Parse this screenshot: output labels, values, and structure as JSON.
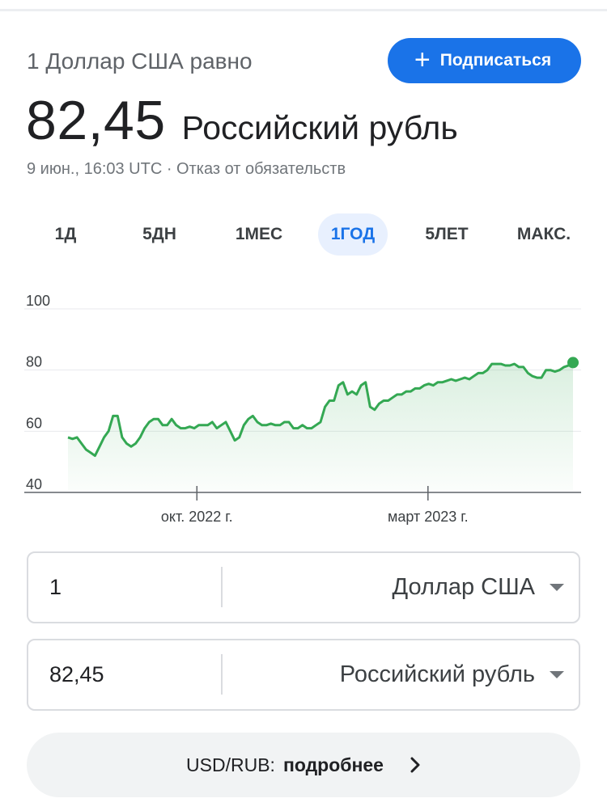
{
  "header": {
    "equals_label": "1 Доллар США равно",
    "subscribe_label": "Подписаться",
    "rate_value": "82,45",
    "rate_currency": "Российский рубль",
    "timestamp": "9 июн., 16:03 UTC · Отказ от обязательств"
  },
  "ranges": {
    "tabs": [
      "1Д",
      "5ДН",
      "1МЕС",
      "1ГОД",
      "5ЛЕТ",
      "МАКС."
    ],
    "active": "1ГОД"
  },
  "colors": {
    "accent": "#1a73e8",
    "line": "#34a853"
  },
  "chart_data": {
    "type": "line",
    "title": "",
    "xlabel": "",
    "ylabel": "",
    "ylim": [
      40,
      100
    ],
    "yticks": [
      "100",
      "80",
      "60",
      "40"
    ],
    "grid": true,
    "legend": "none",
    "x_tick_labels": [
      {
        "label": "окт. 2022 г.",
        "position": 0.31
      },
      {
        "label": "март 2023 г.",
        "position": 0.725
      }
    ],
    "series": [
      {
        "color": "#34a853",
        "values": [
          58,
          57.5,
          58,
          56,
          54,
          53,
          52,
          55,
          58,
          60,
          65,
          65,
          58,
          56,
          55,
          56,
          58,
          61,
          63,
          64,
          64,
          62,
          62,
          64,
          62,
          61,
          61,
          61.5,
          61,
          62,
          62,
          62,
          63,
          61,
          62,
          63,
          60,
          57,
          58,
          62,
          64,
          65,
          63,
          62,
          62,
          62.5,
          62,
          62,
          63,
          63,
          61,
          61,
          62,
          61,
          61,
          62,
          63,
          68,
          70,
          70,
          75,
          76,
          72,
          73,
          72,
          75,
          76,
          68,
          67,
          69,
          70,
          70,
          71,
          72,
          72,
          73,
          73,
          74,
          74,
          75,
          75.5,
          75,
          76,
          76,
          76.5,
          77,
          76.5,
          77,
          77.5,
          77,
          78,
          79,
          79,
          80,
          82,
          82,
          82,
          81.5,
          81.5,
          82,
          81,
          81,
          79,
          78,
          77.5,
          77.5,
          80,
          80,
          79.5,
          80,
          81,
          81.5,
          82.45
        ],
        "last_value": 82.45
      }
    ]
  },
  "converter": {
    "from_amount": "1",
    "from_currency": "Доллар США",
    "to_amount": "82,45",
    "to_currency": "Российский рубль"
  },
  "details": {
    "pair": "USD/RUB:",
    "more": "подробнее"
  }
}
